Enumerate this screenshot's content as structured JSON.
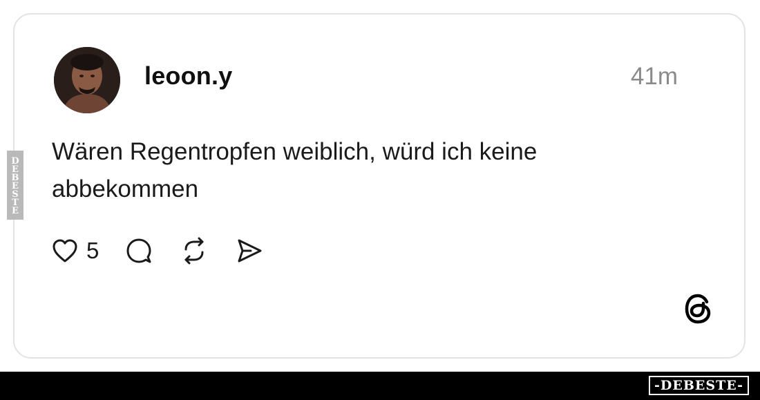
{
  "post": {
    "username": "leoon.y",
    "timestamp": "41m",
    "text": "Wären Regentropfen weiblich, würd ich keine abbekommen",
    "like_count": "5"
  },
  "icons": {
    "like": "heart-icon",
    "reply": "comment-icon",
    "repost": "repost-icon",
    "share": "send-icon",
    "platform": "threads-logo-icon"
  },
  "watermark": {
    "footer": "-DEBESTE-",
    "side": "DEBESTE"
  },
  "colors": {
    "card_border": "#e3e3e3",
    "text": "#1a1a1a",
    "timestamp": "#8a8a8a",
    "footer_bar": "#000000"
  }
}
